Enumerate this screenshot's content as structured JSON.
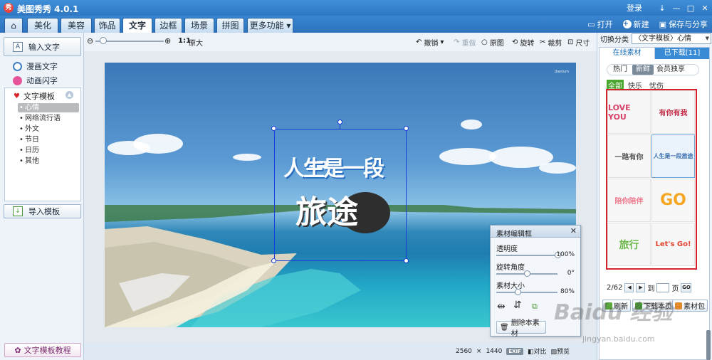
{
  "app": {
    "title": "美图秀秀 4.0.1",
    "logo_text": "秀",
    "login": "登录",
    "window_controls": [
      "↓",
      "—",
      "□",
      "✕"
    ]
  },
  "menu": {
    "home_icon": "home-icon",
    "tabs": [
      "美化",
      "美容",
      "饰品",
      "文字",
      "边框",
      "场景",
      "拼图",
      "更多功能"
    ],
    "active_tab": "文字",
    "open": "打开",
    "new": "新建",
    "save_share": "保存与分享"
  },
  "left": {
    "input_text": "输入文字",
    "comic_text": "漫画文字",
    "animated_text": "动画闪字",
    "template_header": "文字模板",
    "template_subs": [
      "心情",
      "网络流行语",
      "外文",
      "节日",
      "日历",
      "其他"
    ],
    "import_template": "导入模板",
    "tutorial": "文字模板教程"
  },
  "toolbar": {
    "ratio": "1:1",
    "original_size": "原大",
    "undo": "撤销",
    "redo": "重做",
    "original_image": "原图",
    "rotate": "旋转",
    "crop": "裁剪",
    "resize": "尺寸"
  },
  "canvas": {
    "photo_tag": "dianlum",
    "sticker_line1": "人生是一段",
    "sticker_line2": "旅途"
  },
  "editor": {
    "title": "素材编辑框",
    "close": "✕",
    "opacity_label": "透明度",
    "opacity_value": "100%",
    "opacity_level": 1.0,
    "rotate_label": "旋转角度",
    "rotate_value": "0°",
    "rotate_level": 0.5,
    "size_label": "素材大小",
    "size_value": "80%",
    "size_level": 0.35,
    "delete": "删除本素材"
  },
  "status": {
    "width": "2560",
    "times": "×",
    "height": "1440",
    "exif": "EXIF",
    "compare": "对比",
    "preview": "预览"
  },
  "right": {
    "switch_label": "切换分类",
    "switch_value": "〈文字模板〉心情",
    "tab_online": "在线素材",
    "tab_downloaded": "已下载[11]",
    "filters": [
      "热门",
      "新鲜",
      "会员独享"
    ],
    "active_filter": "新鲜",
    "moods": [
      "全部",
      "快乐",
      "忧伤"
    ],
    "active_mood": "全部",
    "stickers": [
      "LOVE YOU",
      "有你有我",
      "一路有你",
      "人生是一段旅途",
      "陪你陪伴",
      "GO",
      "旅行",
      "Let's Go!"
    ],
    "pager_current": "2/62",
    "pager_to": "到",
    "pager_page": "页",
    "pager_go": "GO",
    "refresh": "刷新",
    "download_page": "下载本页",
    "material_pack": "素材包"
  },
  "watermark": {
    "brand": "Baidu 经验",
    "url": "jingyan.baidu.com"
  }
}
